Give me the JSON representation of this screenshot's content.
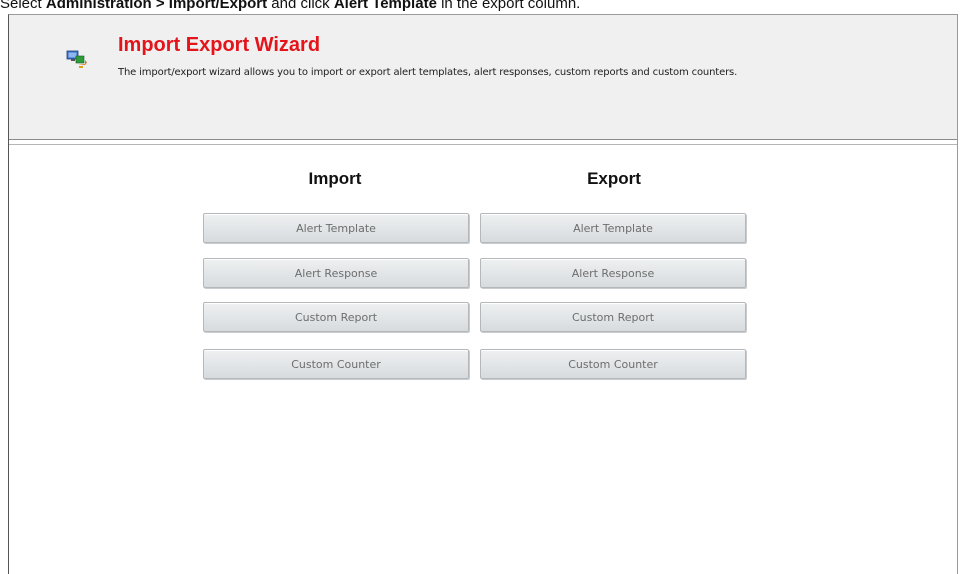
{
  "instruction": {
    "prefix": "Select ",
    "path": "Administration > Import/Export",
    "middle": " and click ",
    "target": "Alert Template",
    "suffix": " in the export column."
  },
  "wizard": {
    "title": "Import Export Wizard",
    "description": "The import/export wizard allows you to import or export alert templates, alert responses, custom reports and custom counters."
  },
  "import": {
    "heading": "Import",
    "buttons": [
      "Alert Template",
      "Alert Response",
      "Custom Report",
      "Custom Counter"
    ]
  },
  "export": {
    "heading": "Export",
    "buttons": [
      "Alert Template",
      "Alert Response",
      "Custom Report",
      "Custom Counter"
    ]
  },
  "colors": {
    "title": "#e4141b",
    "header_bg": "#f0f0f0",
    "button_text": "#6d6d6d"
  },
  "icons": {
    "wizard_logo": "import-export-wizard-icon"
  }
}
